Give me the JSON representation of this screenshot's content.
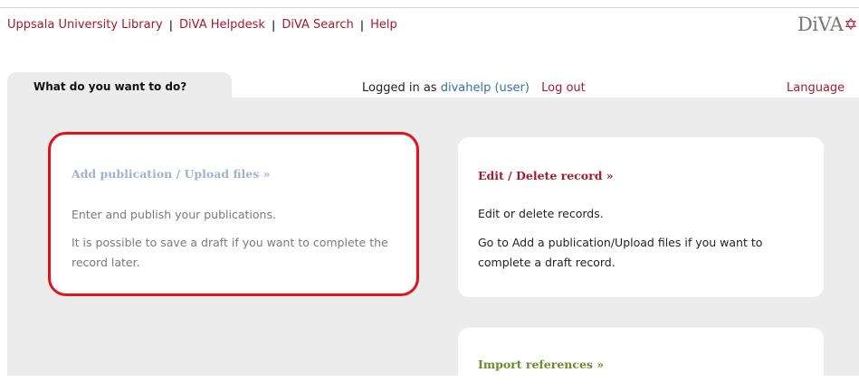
{
  "header": {
    "links": [
      "Uppsala University Library",
      "DiVA Helpdesk",
      "DiVA Search",
      "Help"
    ],
    "separator": "|",
    "logo_text": "DiVA",
    "logo_icon": "star-of-david-icon"
  },
  "tab": {
    "label": "What do you want to do?"
  },
  "session": {
    "prefix": "Logged in as",
    "user": "divahelp (user)",
    "logout": "Log out",
    "language": "Language"
  },
  "cards": [
    {
      "title": "Add publication / Upload files »",
      "lines": [
        "Enter and publish your publications.",
        "It is possible to save a draft if you want to complete the record later."
      ]
    },
    {
      "title": "Edit / Delete record »",
      "lines": [
        "Edit or delete records.",
        "Go to Add a publication/Upload files if you want to complete a draft record."
      ]
    },
    {
      "title": "Import references »",
      "lines": []
    }
  ],
  "colors": {
    "link": "#a6192e",
    "panel": "#ececec",
    "highlight": "#e0141e",
    "add_title": "#9fb4cc",
    "import_title": "#6b8a2f"
  }
}
